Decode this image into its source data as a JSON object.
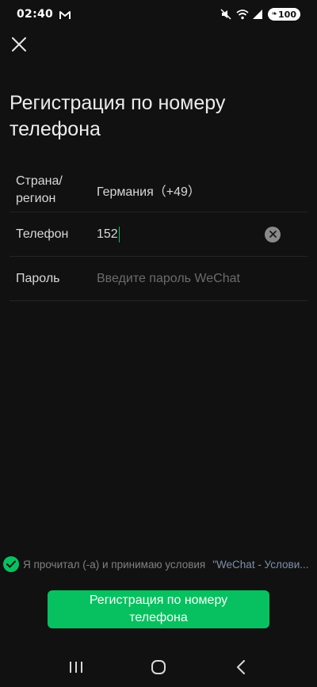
{
  "status_bar": {
    "time": "02:40",
    "battery": "100",
    "icons": [
      "gmail-icon",
      "mute-icon",
      "wifi-icon",
      "signal-icon",
      "battery-icon"
    ]
  },
  "close_icon": "close-icon",
  "title": "Регистрация по номеру телефона",
  "form": {
    "country": {
      "label": "Страна/ регион",
      "value": "Германия（+49）"
    },
    "phone": {
      "label": "Телефон",
      "value": "152"
    },
    "password": {
      "label": "Пароль",
      "placeholder": "Введите пароль WeChat"
    }
  },
  "agreement": {
    "text": "Я прочитал (-а) и принимаю условия",
    "link": "\"WeChat - Услови..."
  },
  "submit_label": "Регистрация по номеру телефона",
  "colors": {
    "accent": "#07c160",
    "background": "#111111",
    "link": "#7d90a9"
  },
  "nav": {
    "icons": [
      "recent-apps-icon",
      "home-icon",
      "back-icon"
    ]
  }
}
